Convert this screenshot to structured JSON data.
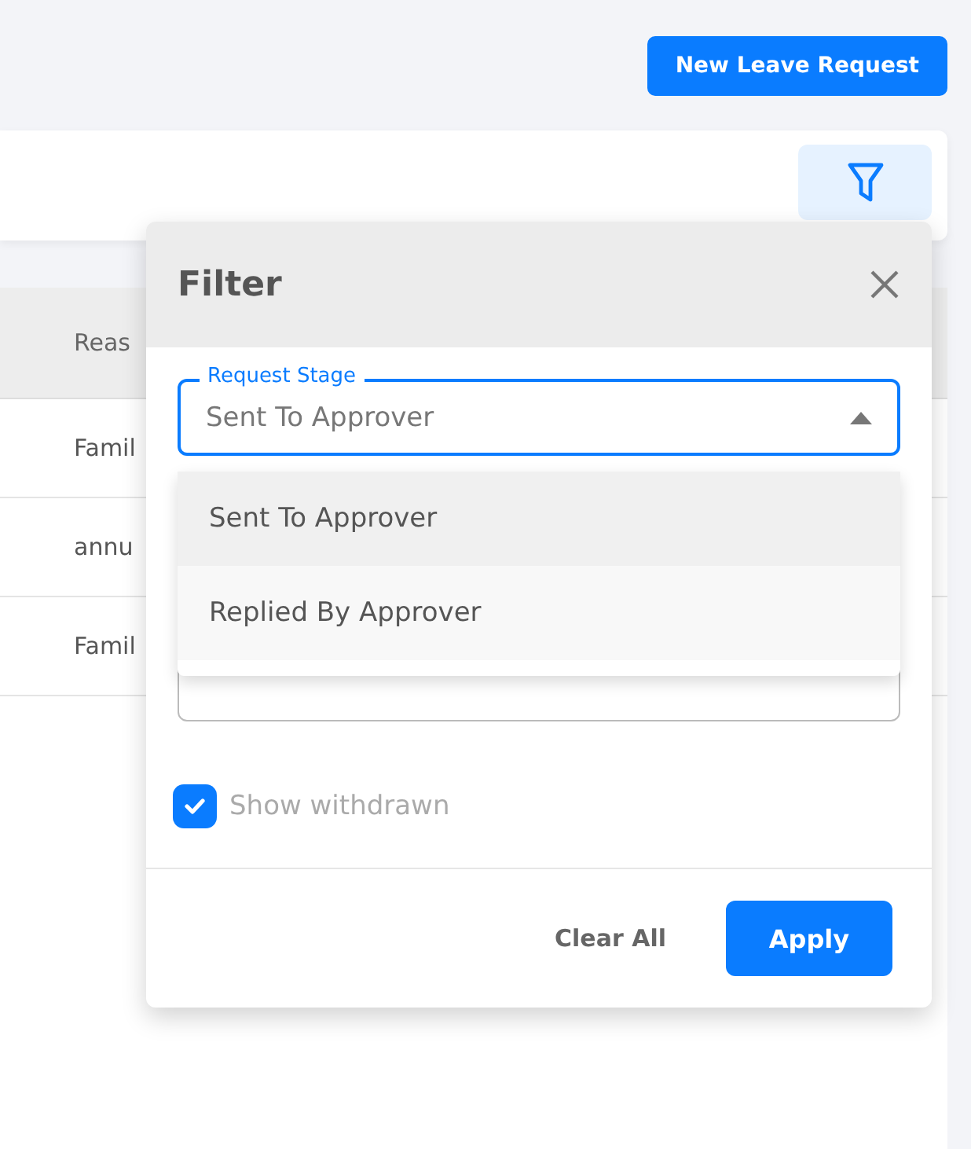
{
  "header": {
    "new_button": "New Leave Request"
  },
  "table": {
    "columns": [
      "Reas"
    ],
    "rows": [
      [
        "Famil"
      ],
      [
        "annu"
      ],
      [
        "Famil"
      ]
    ]
  },
  "filter": {
    "title": "Filter",
    "request_stage": {
      "label": "Request Stage",
      "value": "Sent To Approver",
      "expanded": true,
      "options": [
        {
          "label": "Sent To Approver",
          "selected": true
        },
        {
          "label": "Replied By Approver",
          "selected": false
        }
      ]
    },
    "show_withdrawn": {
      "label": "Show withdrawn",
      "checked": true
    },
    "buttons": {
      "clear": "Clear All",
      "apply": "Apply"
    }
  }
}
